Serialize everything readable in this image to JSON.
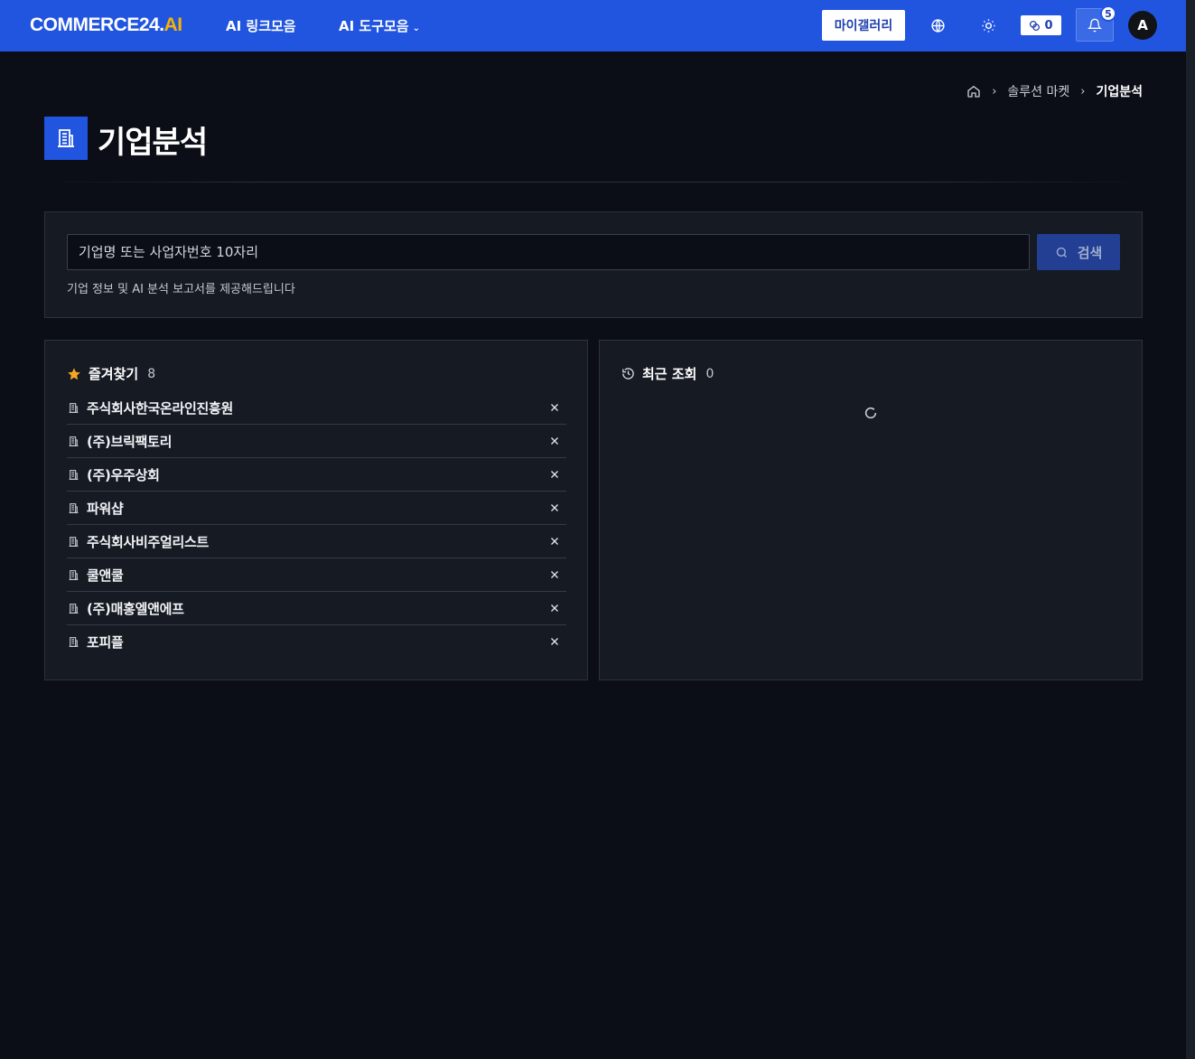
{
  "header": {
    "logo_main": "COMMERCE24.",
    "logo_accent": "AI",
    "nav": [
      {
        "label": "AI 링크모음"
      },
      {
        "label": "AI 도구모음"
      }
    ],
    "gallery_button": "마이갤러리",
    "credits": "0",
    "notification_count": "5",
    "avatar_initial": "A"
  },
  "breadcrumb": {
    "items": [
      "솔루션 마켓"
    ],
    "current": "기업분석"
  },
  "page": {
    "title": "기업분석"
  },
  "search": {
    "placeholder": "기업명 또는 사업자번호 10자리",
    "button_label": "검색",
    "hint": "기업 정보 및 AI 분석 보고서를 제공해드립니다"
  },
  "favorites": {
    "label": "즐겨찾기",
    "count": "8",
    "items": [
      "주식회사한국온라인진흥원",
      "(주)브릭팩토리",
      "(주)우주상회",
      "파워샵",
      "주식회사비주얼리스트",
      "쿨앤쿨",
      "(주)매홍엘앤에프",
      "포피플"
    ]
  },
  "recent": {
    "label": "최근 조회",
    "count": "0"
  },
  "colors": {
    "brand": "#2155e0",
    "logo_accent": "#f5b400",
    "star": "#f5a623",
    "background": "#0b0e16",
    "panel": "#161a23"
  }
}
